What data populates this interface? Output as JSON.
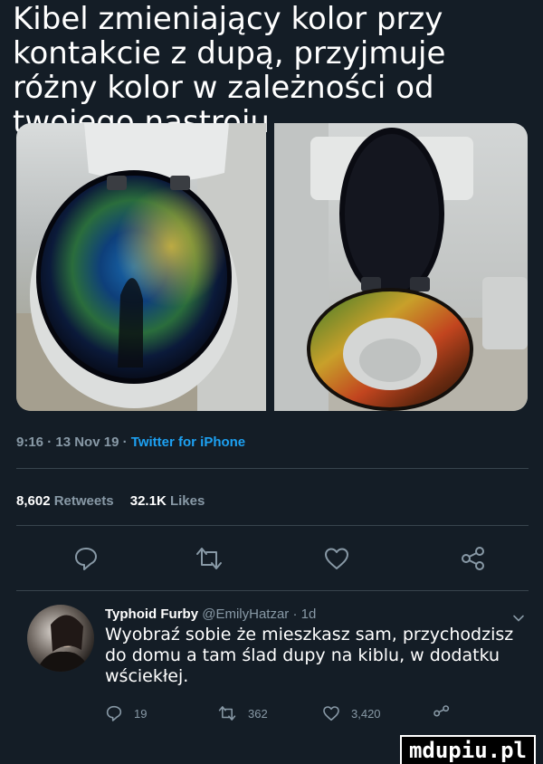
{
  "caption": "Kibel zmieniający kolor przy kontakcie z dupą, przyjmuje różny kolor w zależności od twojego nastroju",
  "tweet_meta": {
    "time": "9:16",
    "date": "13 Nov 19",
    "separator": " · ",
    "source": "Twitter for iPhone"
  },
  "stats": {
    "retweets_count": "8,602",
    "retweets_label": "Retweets",
    "likes_count": "32.1K",
    "likes_label": "Likes"
  },
  "reply": {
    "name": "Typhoid Furby",
    "handle": "@EmilyHatzar",
    "age": " · 1d",
    "text": "Wyobraź sobie że mieszkasz sam, przychodzisz do domu a tam ślad dupy na kiblu, w dodatku wściekłej.",
    "replies": "19",
    "retweets": "362",
    "likes": "3,420"
  },
  "watermark": "mdupiu.pl",
  "colors": {
    "background": "#141d26",
    "secondary_text": "#8899a6",
    "link": "#1da1f2",
    "divider": "#38444d"
  },
  "icons": [
    "reply-icon",
    "retweet-icon",
    "like-icon",
    "share-icon",
    "chevron-down-icon"
  ]
}
